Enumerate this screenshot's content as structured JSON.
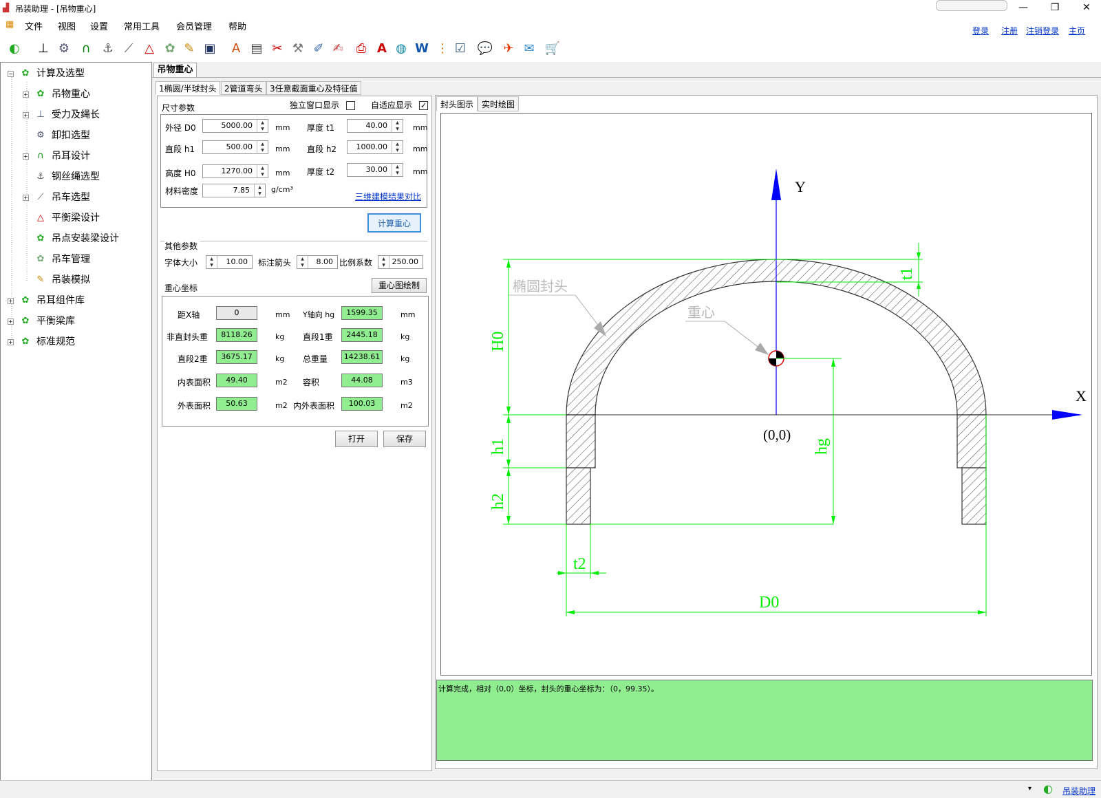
{
  "window": {
    "title": "吊装助理 - [吊物重心]",
    "minimize": "—",
    "restore": "❐",
    "close": "✕"
  },
  "menu": [
    "文件",
    "视图",
    "设置",
    "常用工具",
    "会员管理",
    "帮助"
  ],
  "links": {
    "login": "登录",
    "register": "注册",
    "logout": "注销登录",
    "home": "主页"
  },
  "tree": {
    "root": "计算及选型",
    "items": [
      "吊物重心",
      "受力及绳长",
      "卸扣选型",
      "吊耳设计",
      "钢丝绳选型",
      "吊车选型",
      "平衡梁设计",
      "吊点安装梁设计",
      "吊车管理",
      "吊装模拟"
    ],
    "others": [
      "吊耳组件库",
      "平衡梁库",
      "标准规范"
    ]
  },
  "doc_tab": "吊物重心",
  "subtabs": [
    "1椭圆/半球封头",
    "2管道弯头",
    "3任意截面重心及特征值"
  ],
  "dims": {
    "group": "尺寸参数",
    "standalone_label": "独立窗口显示",
    "adaptive_label": "自适应显示",
    "adaptive_checked": "✓",
    "outer_label": "外径 D0",
    "outer": "5000.00",
    "straight1_label": "直段 h1",
    "straight1": "500.00",
    "height_label": "高度 H0",
    "height": "1270.00",
    "density_label": "材料密度",
    "density": "7.85",
    "density_unit": "g/cm³",
    "thick1_label": "厚度 t1",
    "thick1": "40.00",
    "straight2_label": "直段 h2",
    "straight2": "1000.00",
    "thick2_label": "厚度 t2",
    "thick2": "30.00",
    "unit": "mm",
    "compare_link": "三维建模结果对比"
  },
  "calc_button": "计算重心",
  "other": {
    "group": "其他参数",
    "font_label": "字体大小",
    "font": "10.00",
    "arrow_label": "标注箭头",
    "arrow": "8.00",
    "scale_label": "比例系数",
    "scale": "250.00"
  },
  "cg": {
    "group": "重心坐标",
    "draw_button": "重心图绘制",
    "x_label": "距X轴",
    "x": "0",
    "x_unit": "mm",
    "y_label": "Y轴向 hg",
    "y": "1599.35",
    "y_unit": "mm",
    "head_w_label": "非直封头重",
    "head_w": "8118.26",
    "kg": "kg",
    "s1_w_label": "直段1重",
    "s1_w": "2445.18",
    "s2_w_label": "直段2重",
    "s2_w": "3675.17",
    "total_label": "总重量",
    "total": "14238.61",
    "inner_label": "内表面积",
    "inner": "49.40",
    "m2": "m2",
    "vol_label": "容积",
    "vol": "44.08",
    "m3": "m3",
    "outer_label": "外表面积",
    "outer": "50.63",
    "io_label": "内外表面积",
    "io": "100.03"
  },
  "open_button": "打开",
  "save_button": "保存",
  "right_tabs": [
    "封头图示",
    "实时绘图"
  ],
  "drawing": {
    "y_axis": "Y",
    "x_axis": "X",
    "origin": "(0,0)",
    "head_label": "椭圆封头",
    "cg_label": "重心",
    "t1": "t1",
    "t2": "t2",
    "H0": "H0",
    "h1": "h1",
    "h2": "h2",
    "hg": "hg",
    "D0": "D0"
  },
  "output": "计算完成，相对（0,0）坐标，封头的重心坐标为：（0，99.35）。",
  "status": "吊装助理",
  "colors": {
    "dim_green": "#00ee00",
    "axis_blue": "#0000ff",
    "result_green": "#90ee90"
  },
  "icons": [
    "app-icon",
    "logo-icon",
    "force-icon",
    "shackle-icon",
    "lug-icon",
    "rope-icon",
    "crane-icon",
    "beam-icon",
    "mount-icon",
    "simulate-icon",
    "manage-icon",
    "drawing-icon",
    "calc-icon",
    "cut-icon",
    "tool-icon",
    "paint-icon",
    "pdf-icon",
    "text-icon",
    "globe-icon",
    "word-icon",
    "chart-icon",
    "note-icon",
    "help-icon",
    "plugin-icon",
    "update-icon",
    "cart-icon"
  ]
}
